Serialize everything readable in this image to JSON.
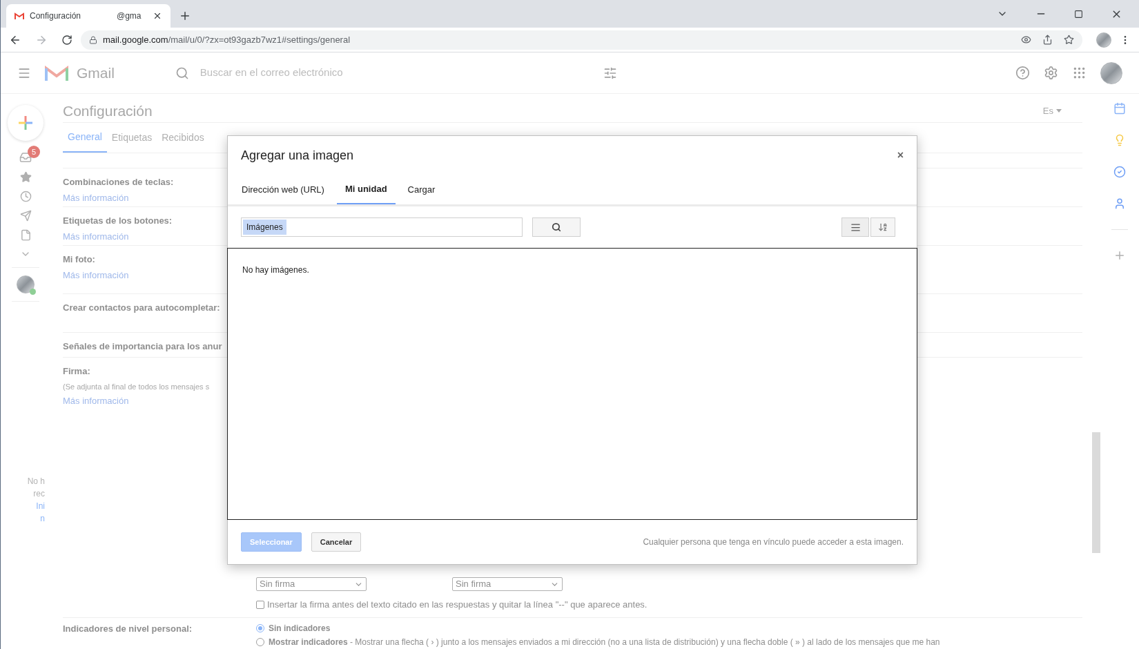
{
  "browser": {
    "tab": {
      "title": "Configuración",
      "account": "@gma"
    },
    "url_host": "mail.google.com",
    "url_path": "/mail/u/0/?zx=ot93gazb7wz1#settings/general"
  },
  "gmail": {
    "brand": "Gmail",
    "search": {
      "placeholder": "Buscar en el correo electrónico"
    }
  },
  "rail": {
    "inbox_badge": "5",
    "online": true,
    "notes": [
      "No h",
      "rec"
    ],
    "links": [
      "Ini",
      "n"
    ]
  },
  "settings": {
    "title": "Configuración",
    "language": "Es",
    "tabs": [
      {
        "label": "General",
        "selected": true
      },
      {
        "label": "Etiquetas",
        "selected": false
      },
      {
        "label": "Recibidos",
        "selected": false
      }
    ],
    "rows": [
      {
        "label": "Combinaciones de teclas:",
        "link": "Más información"
      },
      {
        "label": "Etiquetas de los botones:",
        "link": "Más información"
      },
      {
        "label": "Mi foto:",
        "link": "Más información"
      },
      {
        "label": "Crear contactos para autocompletar:"
      },
      {
        "label": "Señales de importancia para los anur"
      },
      {
        "label": "Firma:",
        "note": "(Se adjunta al final de todos los mensajes s",
        "link": "Más información"
      }
    ],
    "signature_selects": [
      {
        "value": "Sin firma"
      },
      {
        "value": "Sin firma"
      }
    ],
    "insert_before_quote": {
      "label": "Insertar la firma antes del texto citado en las respuestas y quitar la línea \"--\" que aparece antes.",
      "checked": false
    },
    "personal_indicators": {
      "label": "Indicadores de nivel personal:",
      "options": [
        {
          "title": "Sin indicadores",
          "selected": true
        },
        {
          "title": "Mostrar indicadores",
          "text": " - Mostrar una flecha ( › ) junto a los mensajes enviados a mi dirección (no a una lista de distribución) y una flecha doble ( » ) al lado de los mensajes que me han",
          "selected": false
        }
      ]
    }
  },
  "dialog": {
    "title": "Agregar una imagen",
    "close": "×",
    "tabs": [
      {
        "label": "Dirección web (URL)",
        "selected": false
      },
      {
        "label": "Mi unidad",
        "selected": true
      },
      {
        "label": "Cargar",
        "selected": false
      }
    ],
    "search_value": "Imágenes",
    "empty_message": "No hay imágenes.",
    "buttons": [
      {
        "label": "Seleccionar",
        "kind": "primary",
        "disabled": true
      },
      {
        "label": "Cancelar",
        "kind": "secondary",
        "disabled": false
      }
    ],
    "note": "Cualquier persona que tenga en vínculo puede acceder a esta imagen."
  }
}
